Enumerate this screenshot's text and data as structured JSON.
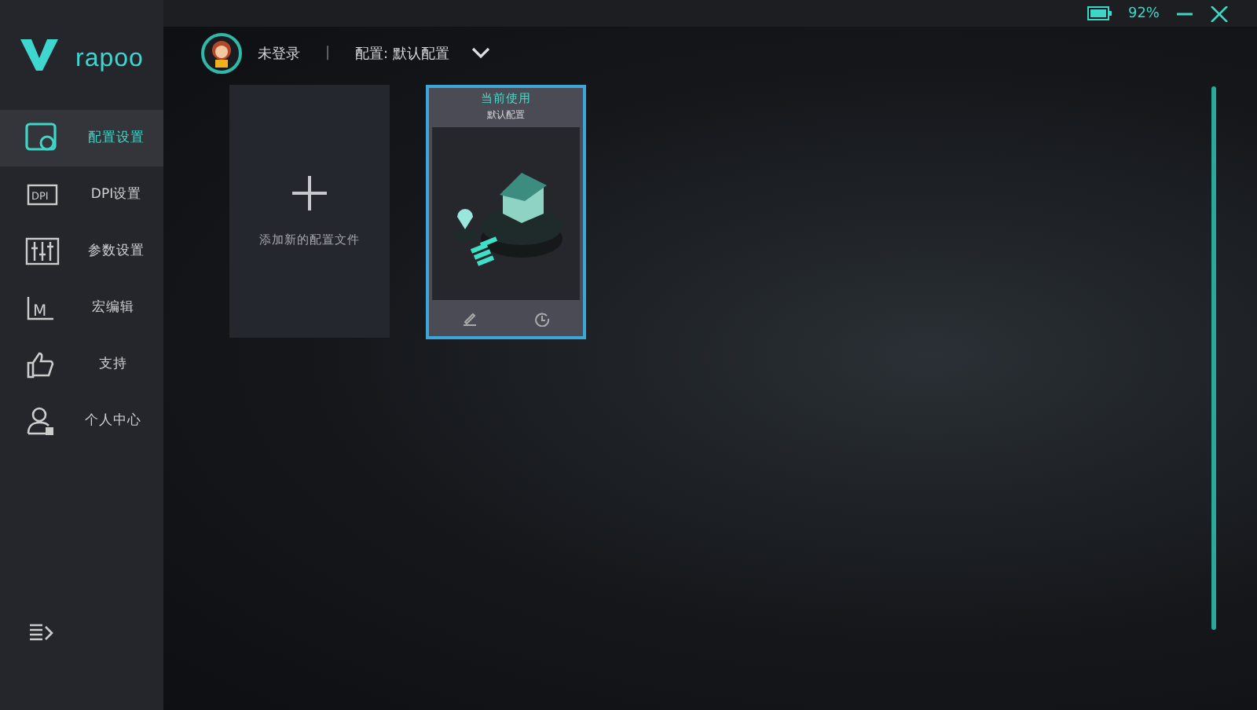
{
  "title_bar": {
    "battery": "92%"
  },
  "logo": {
    "text": "rapoo"
  },
  "header": {
    "user_status": "未登录",
    "separator": "|",
    "profile": "配置: 默认配置"
  },
  "sidebar": {
    "items": [
      {
        "label": "配置设置",
        "selected": true
      },
      {
        "label": "DPI设置",
        "icon_text": "DPI",
        "selected": false
      },
      {
        "label": "参数设置",
        "selected": false
      },
      {
        "label": "宏编辑",
        "icon_text": "M",
        "selected": false
      },
      {
        "label": "支持",
        "selected": false
      },
      {
        "label": "个人中心",
        "selected": false
      }
    ]
  },
  "cards": {
    "add_label": "添加新的配置文件",
    "profiles": [
      {
        "badge": "当前使用",
        "name": "默认配置",
        "selected": true
      }
    ]
  }
}
